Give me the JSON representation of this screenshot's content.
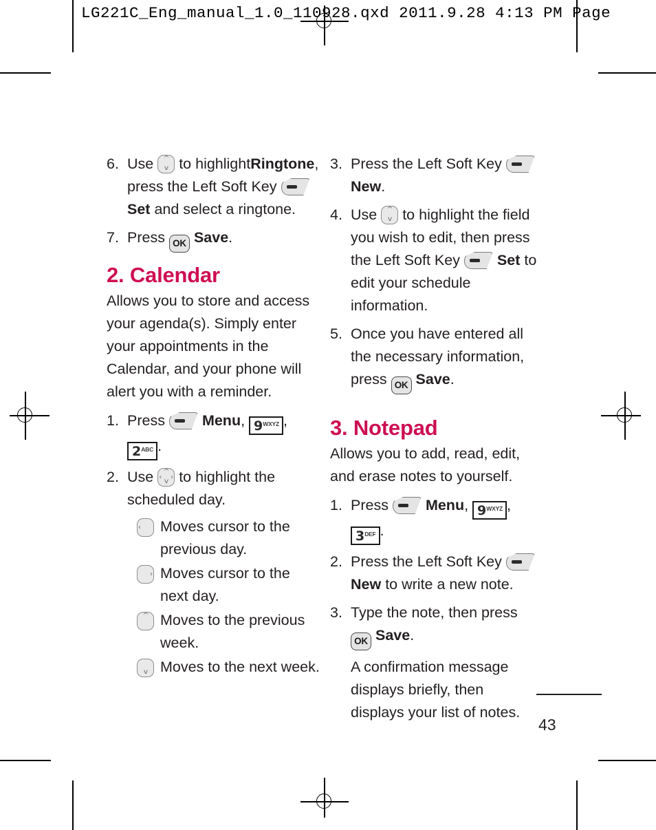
{
  "meta": {
    "slug": "LG221C_Eng_manual_1.0_110928.qxd   2011.9.28   4:13 PM   Page",
    "folio": "43",
    "heading_color": "#ce0e53"
  },
  "icons": {
    "soft_key": "left-soft-key-icon",
    "ok_key": "ok-key-icon",
    "nav_updown": "nav-key-up-down-icon",
    "nav_all": "nav-key-four-way-icon",
    "nav_left": "nav-key-left-icon",
    "nav_right": "nav-key-right-icon",
    "nav_up": "nav-key-up-icon",
    "nav_down": "nav-key-down-icon",
    "ok_label": "OK"
  },
  "keys": {
    "k9": {
      "digit": "9",
      "letters": "WXYZ"
    },
    "k2": {
      "digit": "2",
      "letters": "ABC"
    },
    "k3": {
      "digit": "3",
      "letters": "DEF"
    }
  },
  "left_column": {
    "step6": {
      "num": "6.",
      "t1": "Use",
      "t2": "to highlight",
      "bold1": "Ringtone",
      "t3": ", press the Left Soft Key",
      "bold2": "Set",
      "t4": "and select a ringtone."
    },
    "step7": {
      "num": "7.",
      "t1": "Press",
      "bold1": "Save",
      "t2": "."
    },
    "calendar": {
      "heading": "2. Calendar",
      "intro": "Allows you to store and access your agenda(s). Simply enter your appointments in the Calendar, and your phone will alert you with a reminder.",
      "step1": {
        "num": "1.",
        "t1": "Press",
        "bold1": "Menu",
        "t2": ",",
        "t3": ",",
        "t4": "."
      },
      "step2": {
        "num": "2.",
        "t1": "Use",
        "t2": "to highlight the scheduled day."
      },
      "nav_items": [
        {
          "dir": "left",
          "text": "Moves cursor to the previous day."
        },
        {
          "dir": "right",
          "text": "Moves cursor to the next day."
        },
        {
          "dir": "up",
          "text": "Moves to the previous week."
        },
        {
          "dir": "down",
          "text": "Moves to the next week."
        }
      ]
    }
  },
  "right_column": {
    "step3": {
      "num": "3.",
      "t1": "Press the Left Soft Key",
      "bold1": "New",
      "t2": "."
    },
    "step4": {
      "num": "4.",
      "t1": "Use",
      "t2": "to highlight the field you wish to edit, then press the Left Soft Key",
      "bold1": "Set",
      "t3": "to edit your schedule information."
    },
    "step5": {
      "num": "5.",
      "t1": "Once you have entered all the necessary information, press",
      "bold1": "Save",
      "t2": "."
    },
    "notepad": {
      "heading": "3. Notepad",
      "intro": "Allows you to add, read, edit, and erase notes to yourself.",
      "step1": {
        "num": "1.",
        "t1": "Press",
        "bold1": "Menu",
        "t2": ",",
        "t3": ",",
        "t4": "."
      },
      "step2": {
        "num": "2.",
        "t1": "Press the Left Soft Key",
        "bold1": "New",
        "t2": "to write a new note."
      },
      "step3": {
        "num": "3.",
        "t1": "Type the note, then press",
        "bold1": "Save",
        "t2": "."
      },
      "note": "A confirmation message displays briefly, then displays your list of notes."
    }
  }
}
